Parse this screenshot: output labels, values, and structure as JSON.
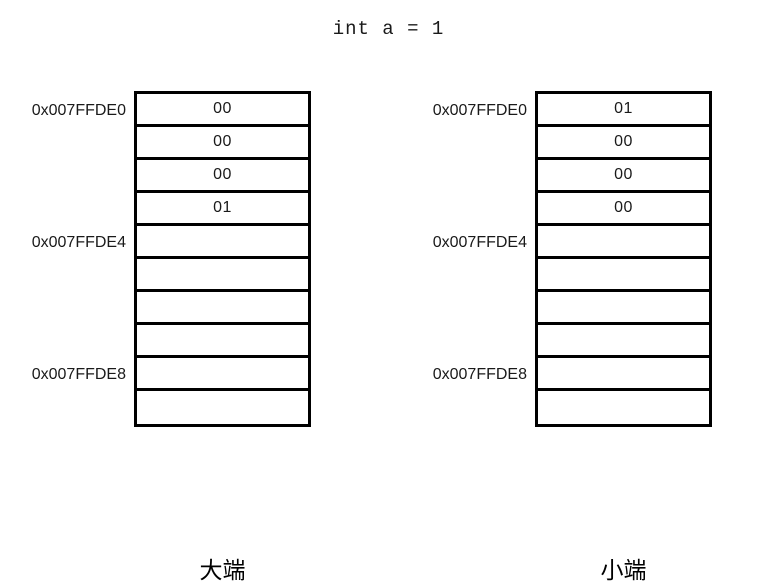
{
  "diagram": {
    "title": "int a = 1",
    "row_count": 10,
    "colors": {
      "background": "#ffffff",
      "stroke": "#000000",
      "text": "#1a1a1a"
    },
    "blocks": [
      {
        "id": "big-endian",
        "caption": "大端",
        "cells": [
          "00",
          "00",
          "00",
          "01",
          "",
          "",
          "",
          "",
          "",
          ""
        ],
        "addresses": [
          {
            "label": "0x007FFDE0",
            "row": 1
          },
          {
            "label": "0x007FFDE4",
            "row": 5
          },
          {
            "label": "0x007FFDE8",
            "row": 9
          }
        ]
      },
      {
        "id": "little-endian",
        "caption": "小端",
        "cells": [
          "01",
          "00",
          "00",
          "00",
          "",
          "",
          "",
          "",
          "",
          ""
        ],
        "addresses": [
          {
            "label": "0x007FFDE0",
            "row": 1
          },
          {
            "label": "0x007FFDE4",
            "row": 5
          },
          {
            "label": "0x007FFDE8",
            "row": 9
          }
        ]
      }
    ]
  }
}
